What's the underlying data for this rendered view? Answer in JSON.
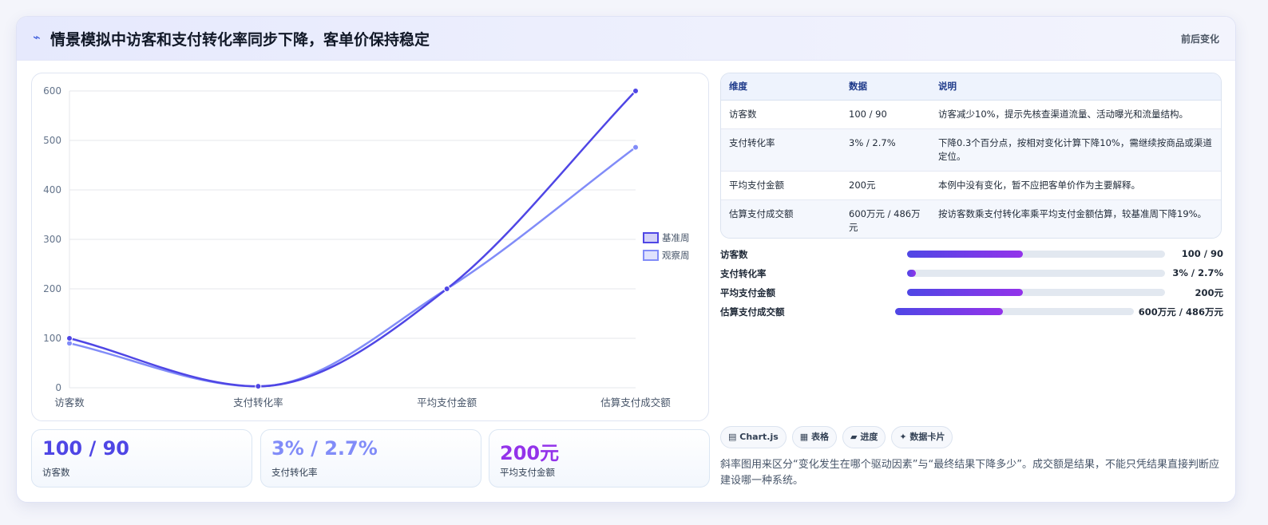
{
  "header": {
    "icon": "lightning-icon",
    "title": "情景模拟中访客和支付转化率同步下降，客单价保持稳定",
    "right_label": "前后变化"
  },
  "chart_data": {
    "type": "line",
    "categories": [
      "访客数",
      "支付转化率",
      "平均支付金额",
      "估算支付成交额"
    ],
    "series": [
      {
        "name": "基准周",
        "values": [
          100,
          3,
          200,
          600
        ],
        "color": "#4f46e5"
      },
      {
        "name": "观察周",
        "values": [
          90,
          2.7,
          200,
          486
        ],
        "color": "#818cf8"
      }
    ],
    "ylim": [
      0,
      600
    ],
    "yticks": [
      0,
      100,
      200,
      300,
      400,
      500,
      600
    ],
    "grid": true,
    "legend_position": "right"
  },
  "stats": [
    {
      "value": "100 / 90",
      "label": "访客数",
      "color": "#4f46e5"
    },
    {
      "value": "3% / 2.7%",
      "label": "支付转化率",
      "color": "#818cf8"
    },
    {
      "value": "200元",
      "label": "平均支付金额",
      "color": "#9333ea"
    }
  ],
  "table": {
    "headers": [
      "维度",
      "数据",
      "说明"
    ],
    "rows": [
      [
        "访客数",
        "100 / 90",
        "访客减少10%，提示先核查渠道流量、活动曝光和流量结构。"
      ],
      [
        "支付转化率",
        "3% / 2.7%",
        "下降0.3个百分点，按相对变化计算下降10%，需继续按商品或渠道定位。"
      ],
      [
        "平均支付金额",
        "200元",
        "本例中没有变化，暂不应把客单价作为主要解释。"
      ],
      [
        "估算支付成交额",
        "600万元 / 486万元",
        "按访客数乘支付转化率乘平均支付金额估算，较基准周下降19%。"
      ]
    ]
  },
  "progress": [
    {
      "label": "访客数",
      "value": "100 / 90",
      "fraction": 0.45
    },
    {
      "label": "支付转化率",
      "value": "3% / 2.7%",
      "fraction": 0.03
    },
    {
      "label": "平均支付金额",
      "value": "200元",
      "fraction": 0.45
    },
    {
      "label": "估算支付成交额",
      "value": "600万元 / 486万元",
      "fraction": 0.45
    }
  ],
  "chips": [
    {
      "icon": "chart-icon",
      "glyph": "▤",
      "label": "Chart.js"
    },
    {
      "icon": "table-icon",
      "glyph": "▦",
      "label": "表格"
    },
    {
      "icon": "progress-icon",
      "glyph": "▰",
      "label": "进度"
    },
    {
      "icon": "sparkle-icon",
      "glyph": "✦",
      "label": "数据卡片"
    }
  ],
  "note": "斜率图用来区分“变化发生在哪个驱动因素”与“最终结果下降多少”。成交额是结果，不能只凭结果直接判断应建设哪一种系统。"
}
